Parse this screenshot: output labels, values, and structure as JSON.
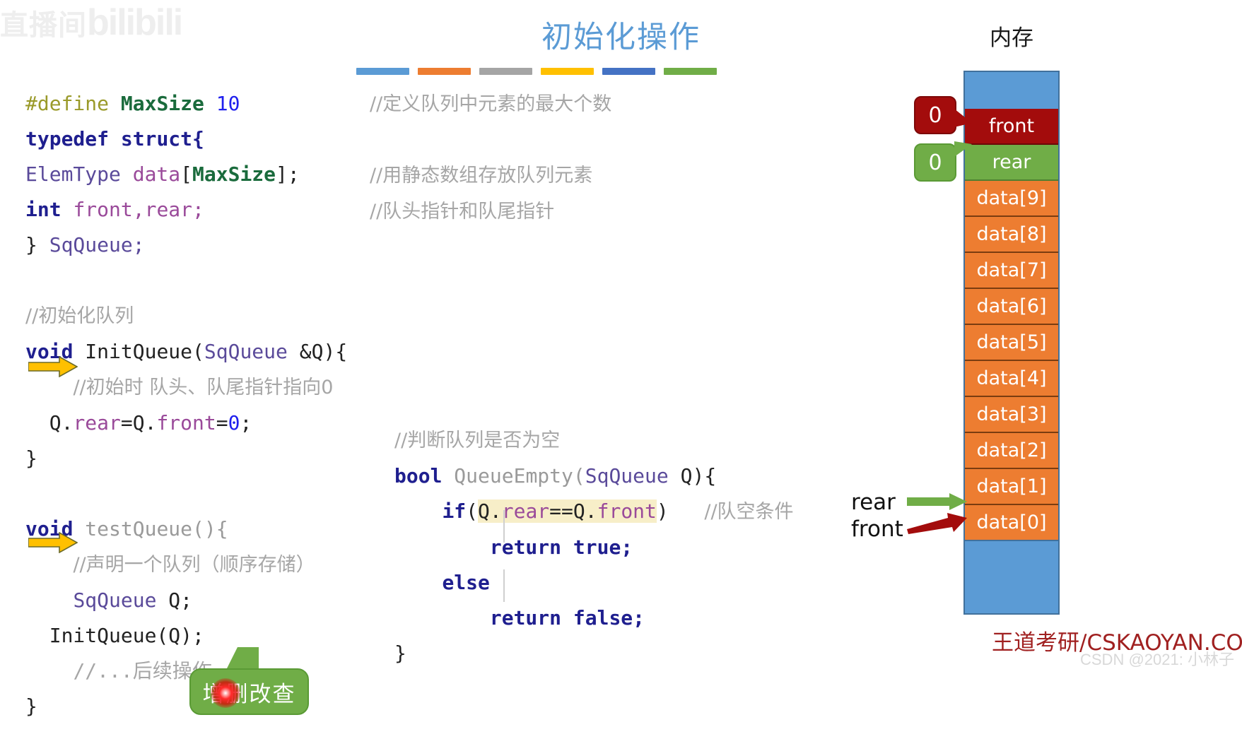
{
  "watermarks": {
    "bili_cn": "直播间",
    "bili_logo": "bilibili",
    "csdn": "CSDN @2021: 小林子",
    "brand": "王道考研/CSKAOYAN.COM"
  },
  "header": {
    "title": "初始化操作",
    "bar_colors": [
      "#5B9BD5",
      "#ED7D31",
      "#A5A5A5",
      "#FFC000",
      "#4472C4",
      "#70AD47"
    ]
  },
  "code": {
    "define_hash": "#define",
    "define_name": "MaxSize",
    "define_value": "10",
    "typedef": "typedef",
    "struct": "struct{",
    "elemtype": "ElemType",
    "data": "data",
    "bracket_open": "[",
    "maxsize_ref": "MaxSize",
    "bracket_close": "];",
    "int_kw": "int",
    "front_rear": "front,rear;",
    "close_sq": "} ",
    "sqqueue_typename": "SqQueue;",
    "comment_init_queue": "//初始化队列",
    "void_kw": "void",
    "initqueue_sig_name": " InitQueue(",
    "sqqueue_param": "SqQueue",
    "initqueue_sig_tail": " &Q){",
    "comment_init_pointers": "//初始时 队头、队尾指针指向0",
    "stmt_q": "Q.",
    "stmt_rear": "rear",
    "stmt_eq1": "=Q.",
    "stmt_front": "front",
    "stmt_eq2": "=",
    "stmt_zero": "0",
    "stmt_semi": ";",
    "brace_close": "}",
    "testqueue_name": " testQueue(){",
    "comment_declare_queue": "//声明一个队列（顺序存储）",
    "sqqueue_decl": "SqQueue",
    "q_decl": " Q;",
    "initqueue_call": "InitQueue(Q);",
    "comment_followup": "//...后续操作...",
    "comment_define_max": "//定义队列中元素的最大个数",
    "comment_static_array": "//用静态数组存放队列元素",
    "comment_head_tail_ptr": "//队头指针和队尾指针"
  },
  "code_empty": {
    "comment_is_empty": "//判断队列是否为空",
    "bool_kw": "bool",
    "queueempty_name": " QueueEmpty(",
    "sqqueue_param": "SqQueue",
    "q_param": " Q){",
    "if_kw": "if",
    "paren_open": "(",
    "cond_q1": "Q.",
    "cond_rear": "rear",
    "cond_eq": "==",
    "cond_q2": "Q.",
    "cond_front": "front",
    "paren_close": ")",
    "comment_empty_condition": "//队空条件",
    "return_kw": "return",
    "true_val": " true;",
    "else_kw": "else",
    "false_val": " false;",
    "brace_close": "}"
  },
  "callout_box": {
    "text": "增删改查"
  },
  "memory": {
    "title": "内存",
    "front_value": "0",
    "rear_value": "0",
    "cells": [
      {
        "label": "",
        "kind": "blue"
      },
      {
        "label": "front",
        "kind": "front"
      },
      {
        "label": "rear",
        "kind": "rear"
      },
      {
        "label": "data[9]",
        "kind": "data"
      },
      {
        "label": "data[8]",
        "kind": "data"
      },
      {
        "label": "data[7]",
        "kind": "data"
      },
      {
        "label": "data[6]",
        "kind": "data"
      },
      {
        "label": "data[5]",
        "kind": "data"
      },
      {
        "label": "data[4]",
        "kind": "data"
      },
      {
        "label": "data[3]",
        "kind": "data"
      },
      {
        "label": "data[2]",
        "kind": "data"
      },
      {
        "label": "data[1]",
        "kind": "data"
      },
      {
        "label": "data[0]",
        "kind": "data"
      },
      {
        "label": "",
        "kind": "blue"
      }
    ],
    "pointer_rear_label": "rear",
    "pointer_front_label": "front",
    "colors": {
      "blue": "#5B9BD5",
      "front_red": "#A30C0C",
      "rear_green": "#70AD47",
      "data_orange": "#ED7D31",
      "arrow_green": "#70AD47",
      "arrow_red": "#A30C0C"
    }
  }
}
